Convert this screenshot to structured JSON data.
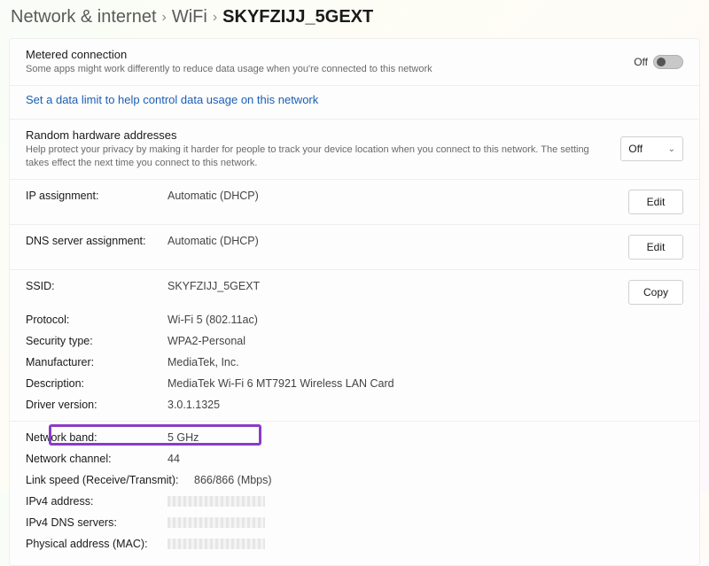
{
  "breadcrumb": {
    "level1": "Network & internet",
    "level2": "WiFi",
    "current": "SKYFZIJJ_5GEXT"
  },
  "metered": {
    "title": "Metered connection",
    "desc": "Some apps might work differently to reduce data usage when you're connected to this network",
    "state_label": "Off"
  },
  "data_limit_link": "Set a data limit to help control data usage on this network",
  "random_hw": {
    "title": "Random hardware addresses",
    "desc": "Help protect your privacy by making it harder for people to track your device location when you connect to this network. The setting takes effect the next time you connect to this network.",
    "value": "Off"
  },
  "ip_assignment": {
    "label": "IP assignment:",
    "value": "Automatic (DHCP)",
    "button": "Edit"
  },
  "dns_assignment": {
    "label": "DNS server assignment:",
    "value": "Automatic (DHCP)",
    "button": "Edit"
  },
  "details": {
    "copy_button": "Copy",
    "ssid": {
      "label": "SSID:",
      "value": "SKYFZIJJ_5GEXT"
    },
    "protocol": {
      "label": "Protocol:",
      "value": "Wi-Fi 5 (802.11ac)"
    },
    "security": {
      "label": "Security type:",
      "value": "WPA2-Personal"
    },
    "manufacturer": {
      "label": "Manufacturer:",
      "value": "MediaTek, Inc."
    },
    "description": {
      "label": "Description:",
      "value": "MediaTek Wi-Fi 6 MT7921 Wireless LAN Card"
    },
    "driver": {
      "label": "Driver version:",
      "value": "3.0.1.1325"
    }
  },
  "details2": {
    "band": {
      "label": "Network band:",
      "value": "5 GHz"
    },
    "channel": {
      "label": "Network channel:",
      "value": "44"
    },
    "link_speed": {
      "label": "Link speed (Receive/Transmit):",
      "value": "866/866 (Mbps)"
    },
    "ipv4": {
      "label": "IPv4 address:"
    },
    "ipv4_dns": {
      "label": "IPv4 DNS servers:"
    },
    "mac": {
      "label": "Physical address (MAC):"
    }
  }
}
